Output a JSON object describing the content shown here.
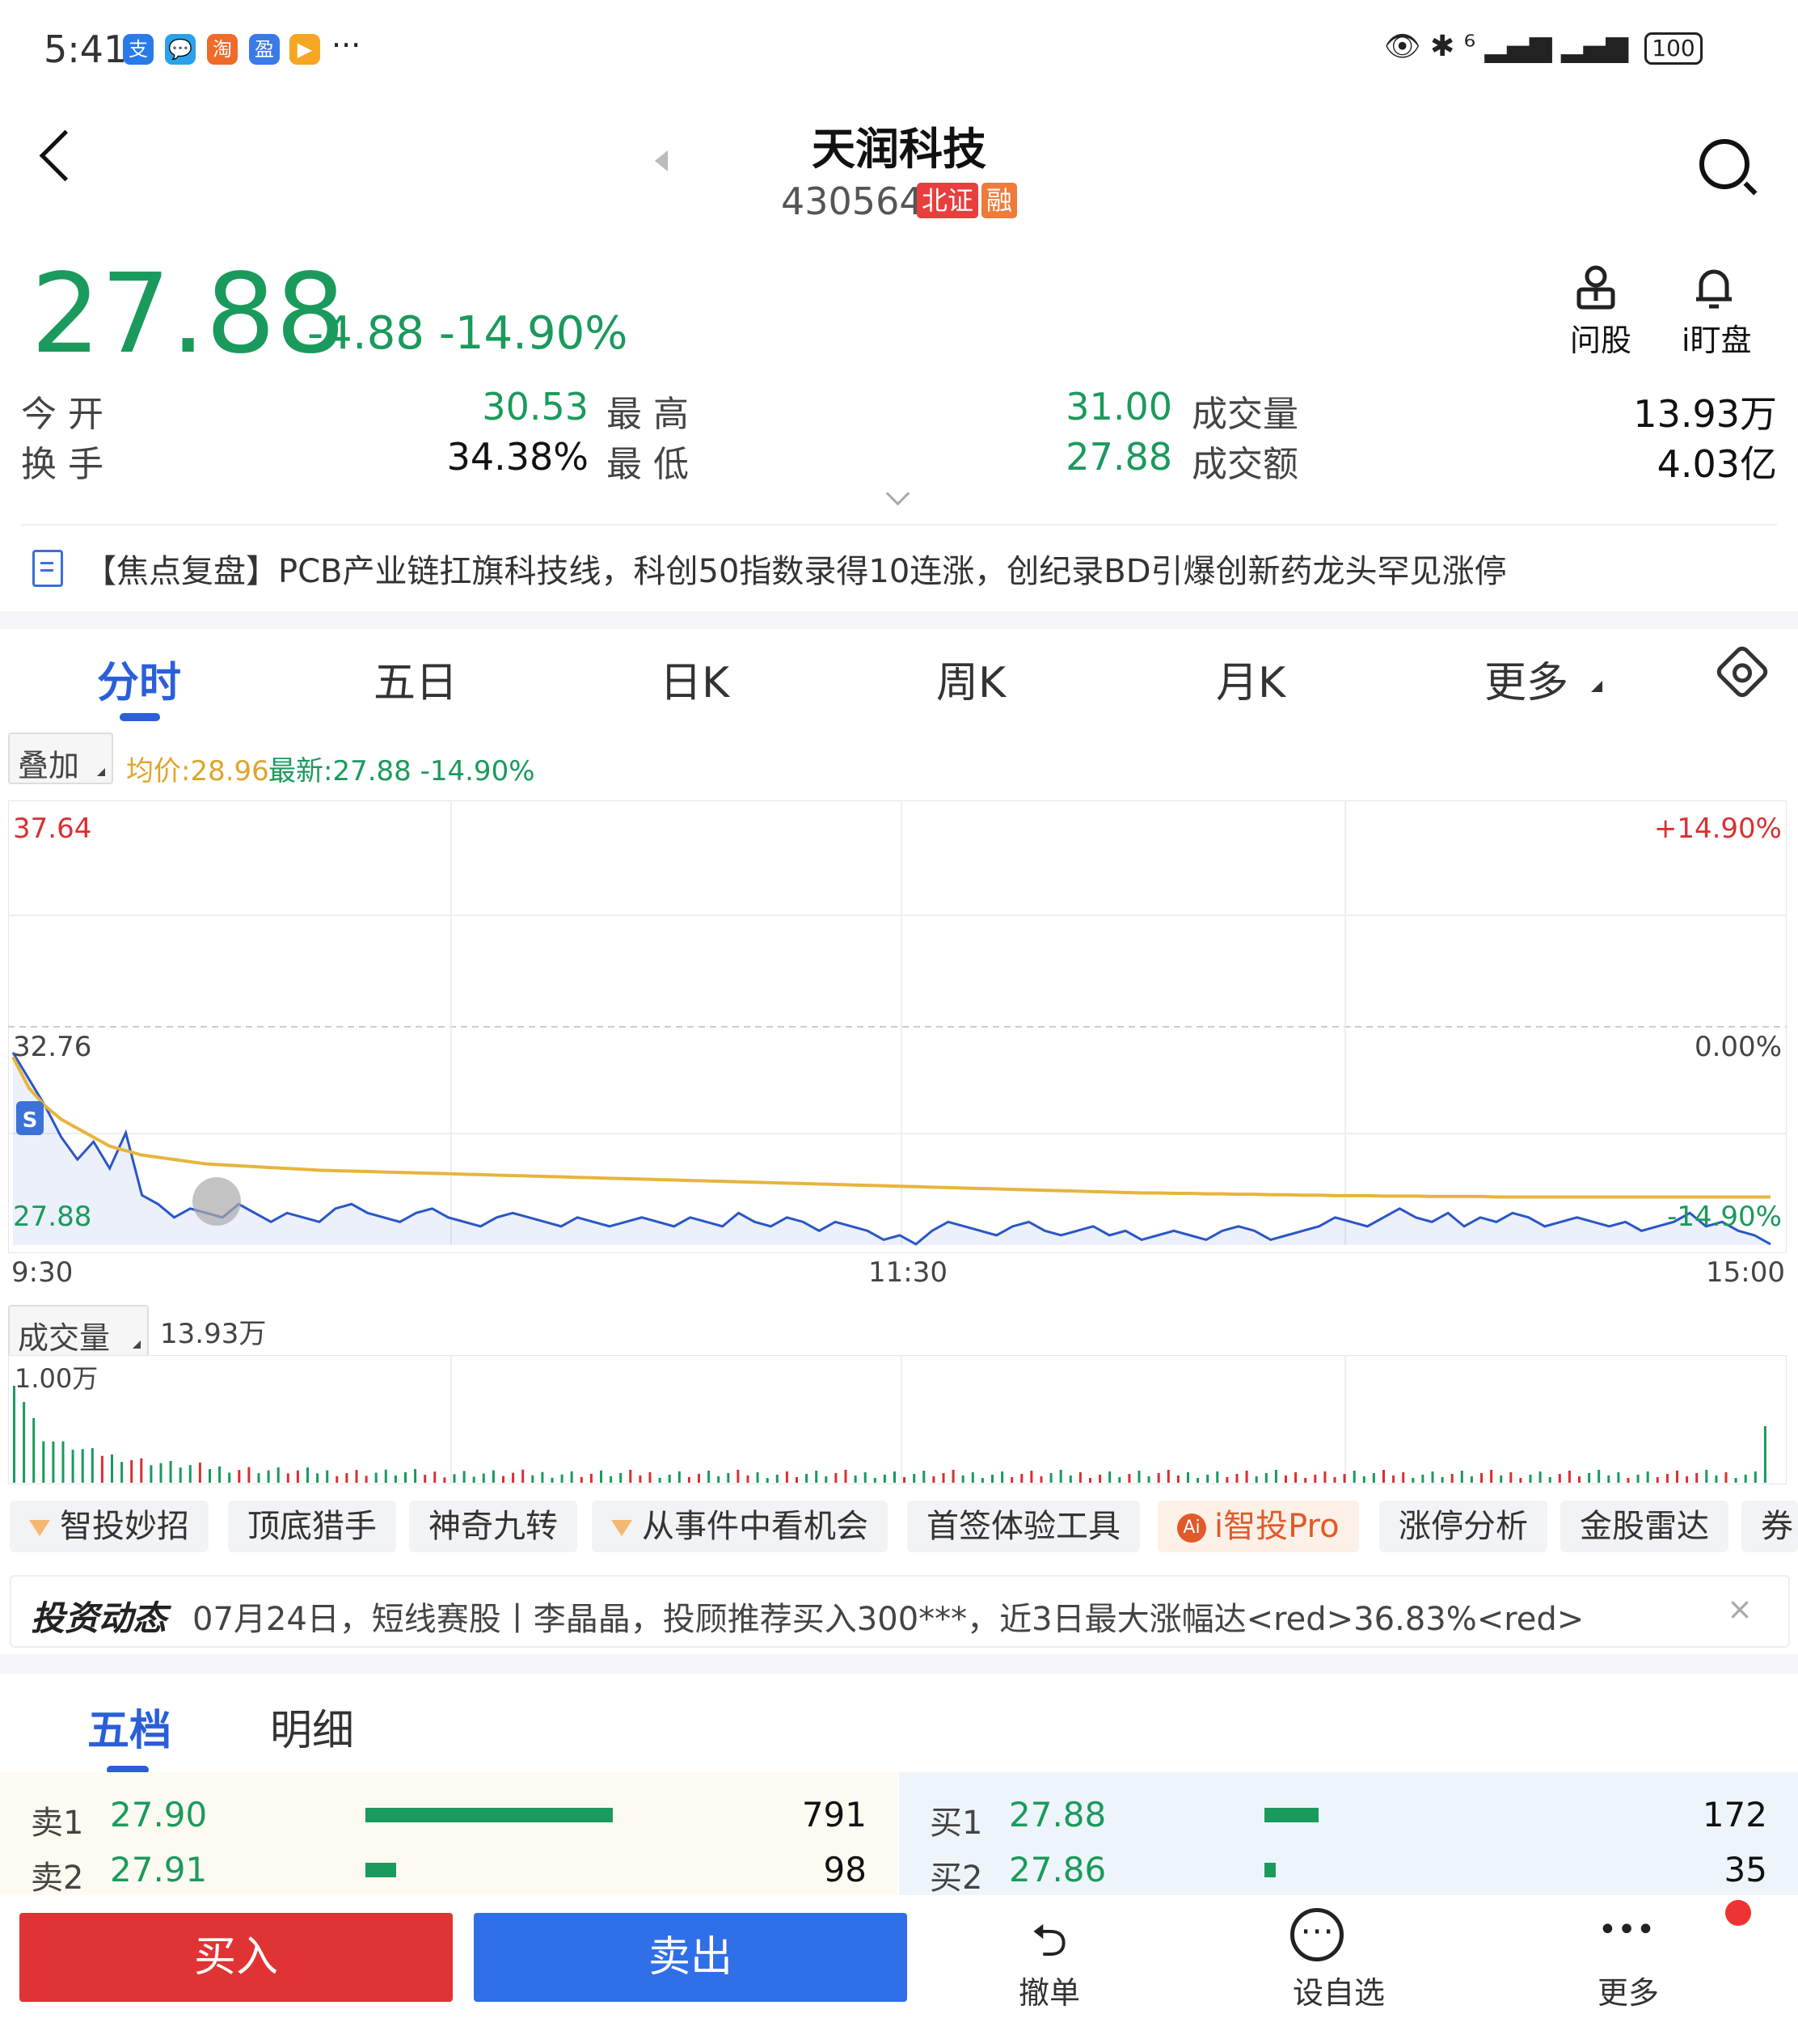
{
  "status_bar": {
    "time": "5:41",
    "apps": [
      "支",
      "💬",
      "淘",
      "盈",
      "▶"
    ],
    "more": "···",
    "right_icons": "👁 ✱ ⁶ ▂▄▆ ▂▄▆",
    "battery": "100"
  },
  "header": {
    "title": "天润科技",
    "code": "430564",
    "tag_market": "北证",
    "tag_margin": "融"
  },
  "quote": {
    "price": "27.88",
    "change": "-4.88 -14.90%"
  },
  "tools": {
    "ask_label": "问股",
    "watch_label": "i盯盘"
  },
  "stats": {
    "open_label": "今  开",
    "open": "30.53",
    "high_label": "最  高",
    "high": "31.00",
    "vol_label": "成交量",
    "vol": "13.93万",
    "turnover_label": "换  手",
    "turnover": "34.38%",
    "low_label": "最  低",
    "low": "27.88",
    "amount_label": "成交额",
    "amount": "4.03亿"
  },
  "news": "【焦点复盘】PCB产业链扛旗科技线，科创50指数录得10连涨，创纪录BD引爆创新药龙头罕见涨停",
  "tabs": [
    "分时",
    "五日",
    "日K",
    "周K",
    "月K",
    "更多"
  ],
  "overlay": {
    "btn": "叠加",
    "avg": "均价:28.96",
    "latest": "最新:27.88 -14.90%"
  },
  "chart_data": {
    "type": "line",
    "x_labels": [
      "9:30",
      "11:30",
      "15:00"
    ],
    "y_left": [
      "37.64",
      "32.76",
      "27.88"
    ],
    "y_right": [
      "+14.90%",
      "0.00%",
      "-14.90%"
    ],
    "ylim": [
      27.88,
      37.64
    ],
    "marker": "S",
    "series": [
      {
        "name": "最新",
        "color": "#2a56c6",
        "values": [
          32.2,
          31.6,
          31.0,
          30.3,
          29.8,
          30.2,
          29.6,
          30.4,
          29.0,
          28.8,
          28.5,
          28.7,
          28.6,
          28.5,
          28.8,
          28.6,
          28.4,
          28.6,
          28.5,
          28.4,
          28.7,
          28.8,
          28.6,
          28.5,
          28.4,
          28.6,
          28.7,
          28.5,
          28.4,
          28.3,
          28.5,
          28.6,
          28.5,
          28.4,
          28.3,
          28.5,
          28.4,
          28.3,
          28.4,
          28.5,
          28.4,
          28.3,
          28.5,
          28.4,
          28.3,
          28.6,
          28.4,
          28.3,
          28.5,
          28.4,
          28.2,
          28.4,
          28.3,
          28.2,
          28.0,
          28.1,
          27.9,
          28.2,
          28.4,
          28.3,
          28.2,
          28.1,
          28.3,
          28.4,
          28.2,
          28.1,
          28.2,
          28.3,
          28.1,
          28.2,
          28.0,
          28.1,
          28.2,
          28.1,
          28.0,
          28.2,
          28.3,
          28.2,
          28.0,
          28.1,
          28.2,
          28.3,
          28.5,
          28.4,
          28.3,
          28.5,
          28.7,
          28.5,
          28.4,
          28.6,
          28.3,
          28.5,
          28.4,
          28.6,
          28.5,
          28.3,
          28.4,
          28.5,
          28.4,
          28.3,
          28.4,
          28.2,
          28.3,
          28.4,
          28.6,
          28.3,
          28.4,
          28.2,
          28.1,
          27.9
        ]
      },
      {
        "name": "均价",
        "color": "#e8b43c",
        "values": [
          32.1,
          31.4,
          31.0,
          30.7,
          30.5,
          30.3,
          30.1,
          30.0,
          29.9,
          29.85,
          29.8,
          29.75,
          29.7,
          29.68,
          29.66,
          29.64,
          29.62,
          29.6,
          29.58,
          29.56,
          29.55,
          29.54,
          29.53,
          29.52,
          29.51,
          29.5,
          29.49,
          29.48,
          29.47,
          29.46,
          29.45,
          29.44,
          29.43,
          29.42,
          29.41,
          29.4,
          29.39,
          29.38,
          29.37,
          29.36,
          29.35,
          29.34,
          29.33,
          29.32,
          29.31,
          29.3,
          29.29,
          29.28,
          29.27,
          29.26,
          29.25,
          29.24,
          29.23,
          29.22,
          29.21,
          29.2,
          29.19,
          29.18,
          29.17,
          29.16,
          29.15,
          29.14,
          29.13,
          29.12,
          29.11,
          29.1,
          29.09,
          29.08,
          29.07,
          29.06,
          29.05,
          29.05,
          29.04,
          29.04,
          29.03,
          29.03,
          29.02,
          29.02,
          29.01,
          29.01,
          29.0,
          29.0,
          28.99,
          28.99,
          28.99,
          28.98,
          28.98,
          28.98,
          28.97,
          28.97,
          28.97,
          28.97,
          28.96,
          28.96,
          28.96,
          28.96,
          28.96,
          28.96,
          28.96,
          28.96,
          28.96,
          28.96,
          28.96,
          28.96,
          28.96,
          28.96,
          28.96,
          28.96,
          28.96,
          28.96
        ]
      }
    ]
  },
  "volume": {
    "btn": "成交量",
    "total": "13.93万",
    "scale": "1.00万"
  },
  "chips": [
    "智投妙招",
    "顶底猎手",
    "神奇九转",
    "从事件中看机会",
    "首签体验工具",
    "i智投Pro",
    "涨停分析",
    "金股雷达",
    "券"
  ],
  "invest": {
    "label": "投资动态",
    "text": "07月24日，短线赛股丨李晶晶，投顾推荐买入300***，近3日最大涨幅达<red>36.83%<red>",
    "close": "×"
  },
  "orderbook": {
    "tabs": [
      "五档",
      "明细"
    ],
    "sell": [
      {
        "label": "卖1",
        "price": "27.90",
        "vol": "791"
      },
      {
        "label": "卖2",
        "price": "27.91",
        "vol": "98"
      }
    ],
    "buy": [
      {
        "label": "买1",
        "price": "27.88",
        "vol": "172"
      },
      {
        "label": "买2",
        "price": "27.86",
        "vol": "35"
      }
    ]
  },
  "bottom": {
    "buy": "买入",
    "sell": "卖出",
    "cancel": "撤单",
    "watch": "设自选",
    "more": "更多",
    "cancel_icon": "⮌",
    "watch_icon": "⋯",
    "more_icon": "•••"
  }
}
